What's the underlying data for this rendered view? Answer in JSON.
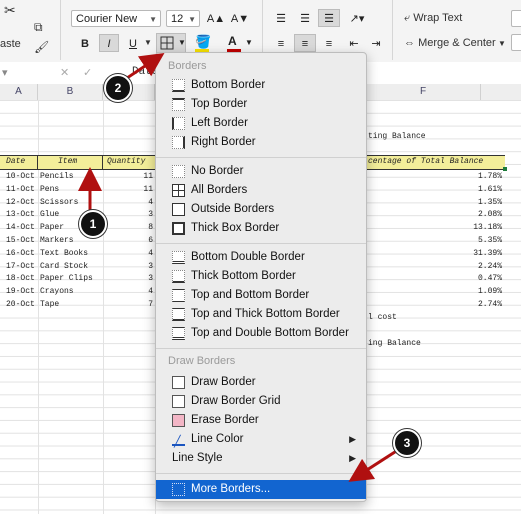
{
  "ribbon": {
    "paste_label": "aste",
    "font_name": "Courier New",
    "font_size": "12",
    "grow_font": "A▲",
    "shrink_font": "A▼",
    "bold": "B",
    "italic": "I",
    "underline": "U",
    "wrap_text": "Wrap Text",
    "merge_center": "Merge & Center"
  },
  "formula_bar": {
    "cancel": "✕",
    "confirm": "✓",
    "fx": "Date"
  },
  "columns": [
    "A",
    "B",
    "F"
  ],
  "sheet": {
    "balance_label_top": "ting Balance",
    "headers": {
      "date": "Date",
      "item": "Item",
      "quantity": "Quantity",
      "pct": "centage of Total Balance"
    },
    "rows": [
      {
        "date": "10-Oct",
        "item": "Pencils",
        "qty": "11",
        "pct": "1.78%"
      },
      {
        "date": "11-Oct",
        "item": "Pens",
        "qty": "11",
        "pct": "1.61%"
      },
      {
        "date": "12-Oct",
        "item": "Scissors",
        "qty": "4",
        "pct": "1.35%"
      },
      {
        "date": "13-Oct",
        "item": "Glue",
        "qty": "3",
        "pct": "2.08%"
      },
      {
        "date": "14-Oct",
        "item": "Paper",
        "qty": "8",
        "pct": "13.18%"
      },
      {
        "date": "15-Oct",
        "item": "Markers",
        "qty": "6",
        "pct": "5.35%"
      },
      {
        "date": "16-Oct",
        "item": "Text Books",
        "qty": "4",
        "pct": "31.39%"
      },
      {
        "date": "17-Oct",
        "item": "Card Stock",
        "qty": "3",
        "pct": "2.24%"
      },
      {
        "date": "18-Oct",
        "item": "Paper Clips",
        "qty": "3",
        "pct": "0.47%"
      },
      {
        "date": "19-Oct",
        "item": "Crayons",
        "qty": "4",
        "pct": "1.09%"
      },
      {
        "date": "20-Oct",
        "item": "Tape",
        "qty": "7",
        "pct": "2.74%"
      }
    ],
    "cost_label": "l cost",
    "balance_label_bottom": "ing Balance"
  },
  "menu": {
    "header_borders": "Borders",
    "items_group1": [
      "Bottom Border",
      "Top Border",
      "Left Border",
      "Right Border"
    ],
    "items_group2": [
      "No Border",
      "All Borders",
      "Outside Borders",
      "Thick Box Border"
    ],
    "items_group3": [
      "Bottom Double Border",
      "Thick Bottom Border",
      "Top and Bottom Border",
      "Top and Thick Bottom Border",
      "Top and Double Bottom Border"
    ],
    "header_draw": "Draw Borders",
    "items_draw": [
      "Draw Border",
      "Draw Border Grid",
      "Erase Border",
      "Line Color",
      "Line Style"
    ],
    "more_borders": "More Borders..."
  },
  "callouts": [
    "1",
    "2",
    "3"
  ],
  "colors": {
    "callout": "#111111",
    "arrow": "#b01010",
    "selection": "#1265d0",
    "header_fill": "#f3ee9a"
  }
}
